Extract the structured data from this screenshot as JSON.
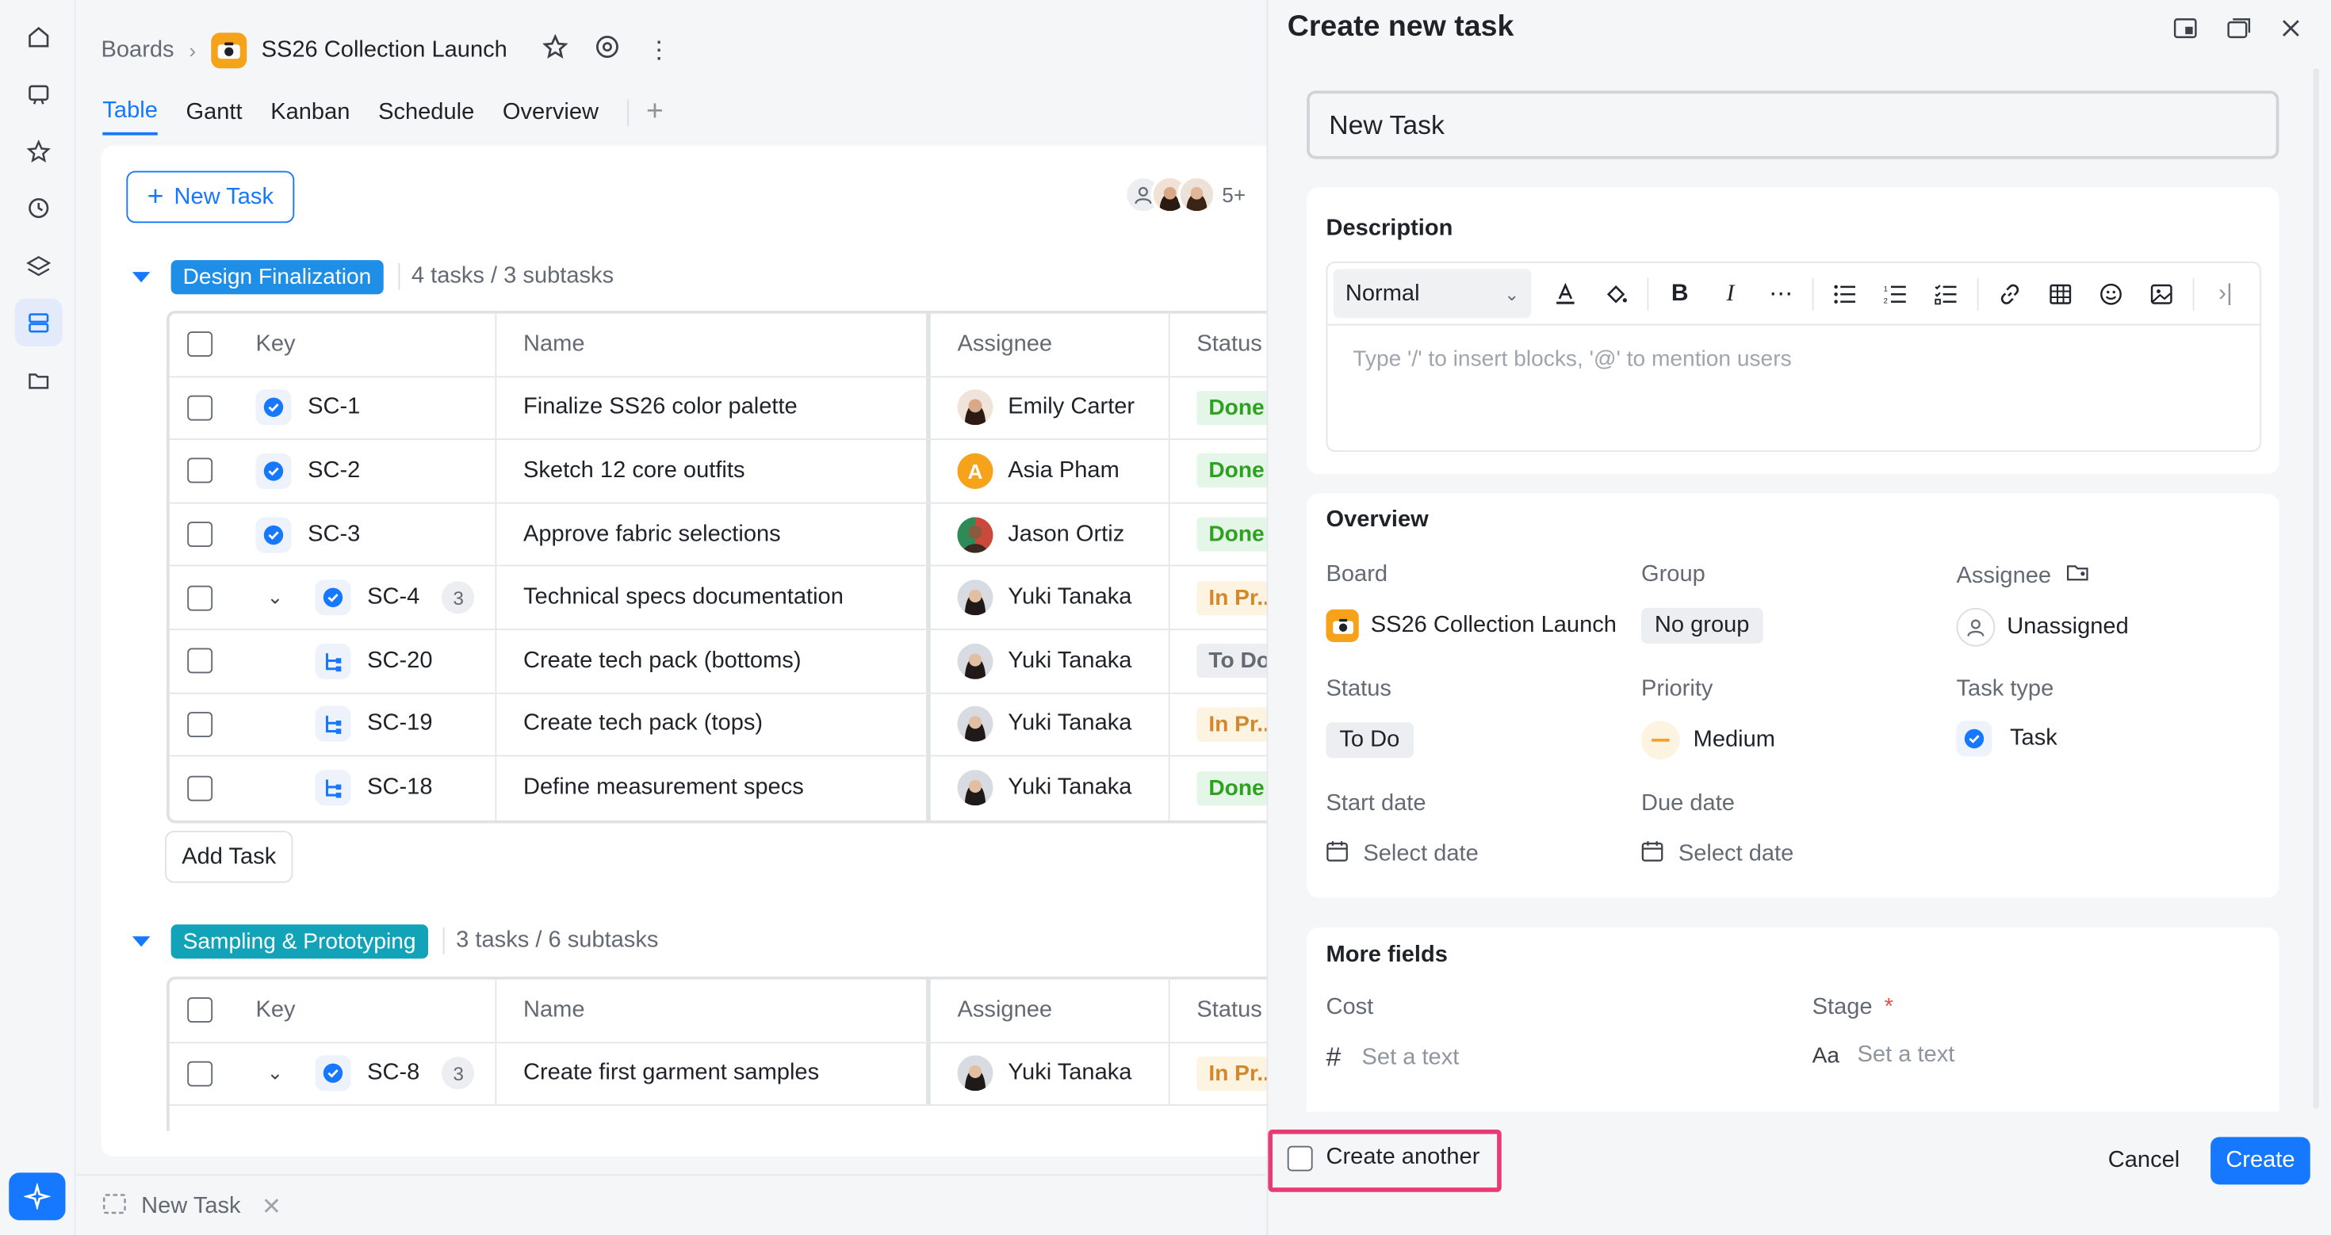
{
  "breadcrumb": {
    "boards": "Boards",
    "project": "SS26 Collection Launch"
  },
  "tabs": [
    "Table",
    "Gantt",
    "Kanban",
    "Schedule",
    "Overview"
  ],
  "toolbar": {
    "new_task": "New Task",
    "members_more": "5+"
  },
  "groups": [
    {
      "name": "Design Finalization",
      "color": "#1e8ee6",
      "count": "4 tasks / 3 subtasks"
    },
    {
      "name": "Sampling & Prototyping",
      "color": "#12a3b8",
      "count": "3 tasks / 6 subtasks"
    }
  ],
  "columns": {
    "key": "Key",
    "name": "Name",
    "assignee": "Assignee",
    "status": "Status"
  },
  "rows_group1": [
    {
      "key": "SC-1",
      "name": "Finalize SS26 color palette",
      "assignee": "Emily Carter",
      "status": "Done"
    },
    {
      "key": "SC-2",
      "name": "Sketch 12 core outfits",
      "assignee": "Asia Pham",
      "status": "Done"
    },
    {
      "key": "SC-3",
      "name": "Approve fabric selections",
      "assignee": "Jason Ortiz",
      "status": "Done"
    },
    {
      "key": "SC-4",
      "name": "Technical specs documentation",
      "assignee": "Yuki Tanaka",
      "status": "In Pr...",
      "subtasks": "3"
    },
    {
      "key": "SC-20",
      "name": "Create tech pack (bottoms)",
      "assignee": "Yuki Tanaka",
      "status": "To Do"
    },
    {
      "key": "SC-19",
      "name": "Create tech pack (tops)",
      "assignee": "Yuki Tanaka",
      "status": "In Pr..."
    },
    {
      "key": "SC-18",
      "name": "Define measurement specs",
      "assignee": "Yuki Tanaka",
      "status": "Done"
    }
  ],
  "add_task": "Add Task",
  "rows_group2": [
    {
      "key": "SC-8",
      "name": "Create first garment samples",
      "assignee": "Yuki Tanaka",
      "status": "In Pr...",
      "subtasks": "3"
    }
  ],
  "bottom_tab": "New Task",
  "panel": {
    "title": "Create new task",
    "task_title": "New Task",
    "description_label": "Description",
    "text_style": "Normal",
    "editor_placeholder": "Type '/' to insert blocks, '@' to mention users",
    "overview_label": "Overview",
    "board_label": "Board",
    "board_value": "SS26 Collection Launch",
    "group_label": "Group",
    "group_value": "No group",
    "assignee_label": "Assignee",
    "assignee_value": "Unassigned",
    "status_label": "Status",
    "status_value": "To Do",
    "priority_label": "Priority",
    "priority_value": "Medium",
    "tasktype_label": "Task type",
    "tasktype_value": "Task",
    "start_label": "Start date",
    "start_value": "Select date",
    "due_label": "Due date",
    "due_value": "Select date",
    "more_fields_label": "More fields",
    "cost_label": "Cost",
    "cost_placeholder": "Set a text",
    "stage_label": "Stage",
    "stage_required": "*",
    "stage_placeholder": "Set a text",
    "create_another": "Create another",
    "cancel": "Cancel",
    "create": "Create"
  },
  "colors": {
    "accent": "#1677ff",
    "done": "#2ea121",
    "progress": "#d4882b",
    "highlight": "#ea3a73"
  }
}
